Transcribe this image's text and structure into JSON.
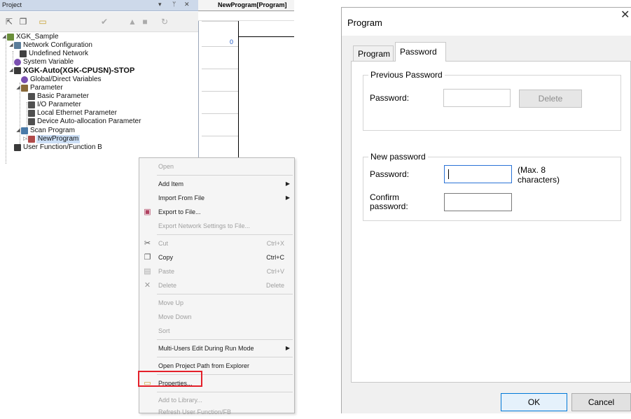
{
  "project_panel": {
    "title": "Project",
    "pin_label": "▾ ⊥ ✕",
    "tree": {
      "root": "XGK_Sample",
      "network_configuration": "Network Configuration",
      "undefined_network": "Undefined Network",
      "system_variable": "System Variable",
      "plc": "XGK-Auto(XGK-CPUSN)-STOP",
      "global_direct_variables": "Global/Direct Variables",
      "parameter": "Parameter",
      "basic_parameter": "Basic Parameter",
      "io_parameter": "I/O Parameter",
      "local_ethernet_parameter": "Local Ethernet Parameter",
      "device_auto_allocation_parameter": "Device Auto-allocation Parameter",
      "scan_program": "Scan Program",
      "new_program": "NewProgram",
      "user_function_block": "User Function/Function B"
    }
  },
  "editor": {
    "tab_title": "NewProgram[Program]",
    "rung_number": "0"
  },
  "context_menu": {
    "items": [
      {
        "label": "Open",
        "shortcut": "",
        "disabled": true
      },
      {
        "label": "Add Item",
        "shortcut": "",
        "disabled": false
      },
      {
        "label": "Import From File",
        "shortcut": "",
        "disabled": false
      },
      {
        "label": "Export to File...",
        "shortcut": "",
        "disabled": false
      },
      {
        "label": "Export Network Settings to File...",
        "shortcut": "",
        "disabled": true
      },
      {
        "label": "Cut",
        "shortcut": "Ctrl+X",
        "disabled": true
      },
      {
        "label": "Copy",
        "shortcut": "Ctrl+C",
        "disabled": false
      },
      {
        "label": "Paste",
        "shortcut": "Ctrl+V",
        "disabled": true
      },
      {
        "label": "Delete",
        "shortcut": "Delete",
        "disabled": true
      },
      {
        "label": "Move Up",
        "shortcut": "",
        "disabled": true
      },
      {
        "label": "Move Down",
        "shortcut": "",
        "disabled": true
      },
      {
        "label": "Sort",
        "shortcut": "",
        "disabled": true
      },
      {
        "label": "Multi-Users Edit During Run Mode",
        "shortcut": "",
        "disabled": false
      },
      {
        "label": "Open Project Path from Explorer",
        "shortcut": "",
        "disabled": false
      },
      {
        "label": "Properties...",
        "shortcut": "",
        "disabled": false
      },
      {
        "label": "Add to Library...",
        "shortcut": "",
        "disabled": true
      },
      {
        "label": "Refresh User Function/FB",
        "shortcut": "",
        "disabled": true
      }
    ]
  },
  "dialog": {
    "title": "Program",
    "close": "✕",
    "tabs": [
      "Program",
      "Password"
    ],
    "active_tab": "Password",
    "previous_password": {
      "group_title": "Previous Password",
      "password_label": "Password:",
      "password_value": "",
      "delete_label": "Delete"
    },
    "new_password": {
      "group_title": "New password",
      "password_label": "Password:",
      "password_value": "",
      "hint_line1": "(Max. 8",
      "hint_line2": "characters)",
      "confirm_label_line1": "Confirm",
      "confirm_label_line2": "password:",
      "confirm_value": ""
    },
    "ok_label": "OK",
    "cancel_label": "Cancel"
  }
}
